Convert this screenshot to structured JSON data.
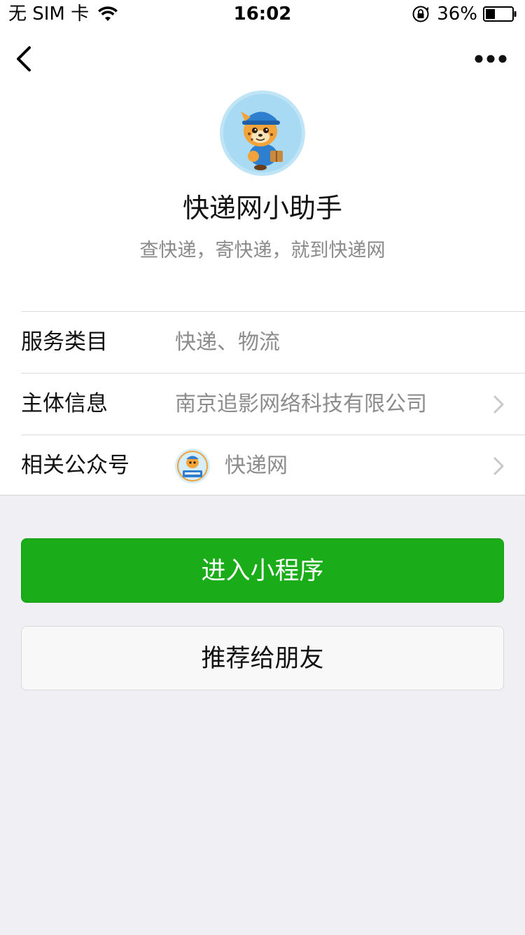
{
  "status_bar": {
    "carrier": "无 SIM 卡",
    "time": "16:02",
    "battery_percent": "36%",
    "battery_level": 0.36
  },
  "nav": {
    "back_icon": "chevron-left-icon",
    "more_icon": "more-dots-icon"
  },
  "profile": {
    "name": "快递网小助手",
    "description": "查快递，寄快递，就到快递网"
  },
  "info": {
    "rows": [
      {
        "label": "服务类目",
        "value": "快递、物流"
      },
      {
        "label": "主体信息",
        "value": "南京追影网络科技有限公司"
      },
      {
        "label": "相关公众号",
        "value": "快递网"
      }
    ]
  },
  "actions": {
    "enter_label": "进入小程序",
    "share_label": "推荐给朋友"
  },
  "colors": {
    "primary_green": "#1aad19",
    "background": "#efeff4",
    "secondary_text": "#8c8c8c"
  }
}
